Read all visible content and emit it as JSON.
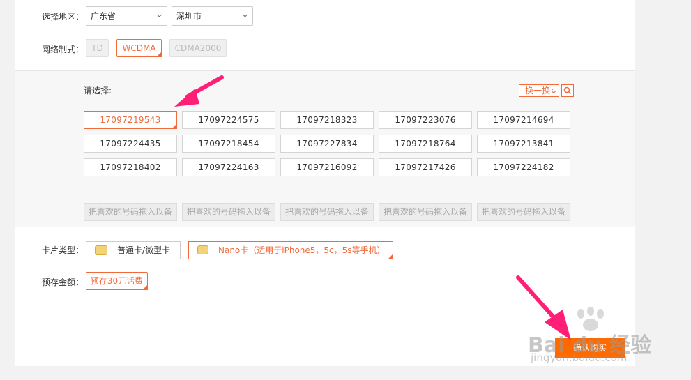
{
  "region": {
    "label": "选择地区：",
    "province": "广东省",
    "city": "深圳市"
  },
  "network": {
    "label": "网络制式：",
    "options": [
      {
        "text": "TD",
        "active": false
      },
      {
        "text": "WCDMA",
        "active": true
      },
      {
        "text": "CDMA2000",
        "active": false
      }
    ]
  },
  "chooser": {
    "label": "请选择:",
    "refresh_label": "换一换",
    "numbers": [
      "17097219543",
      "17097224575",
      "17097218323",
      "17097223076",
      "17097214694",
      "17097224435",
      "17097218454",
      "17097227834",
      "17097218764",
      "17097213841",
      "17097218402",
      "17097224163",
      "17097216092",
      "17097217426",
      "17097224182"
    ],
    "selected_index": 0,
    "drop_slot_text": "把喜欢的号码拖入以备"
  },
  "card_type": {
    "label": "卡片类型：",
    "options": [
      {
        "text": "普通卡/微型卡",
        "active": false
      },
      {
        "text": "Nano卡（适用于iPhone5，5c，5s等手机）",
        "active": true
      }
    ]
  },
  "deposit": {
    "label": "预存金额：",
    "option": "预存30元话费"
  },
  "buy_label": "确认购买",
  "watermark": {
    "brand": "Bai du 经验",
    "url": "jingyan.baidu.com"
  },
  "colors": {
    "accent": "#f26a3a",
    "buy": "#ff6a00",
    "arrow": "#ff1f77"
  }
}
